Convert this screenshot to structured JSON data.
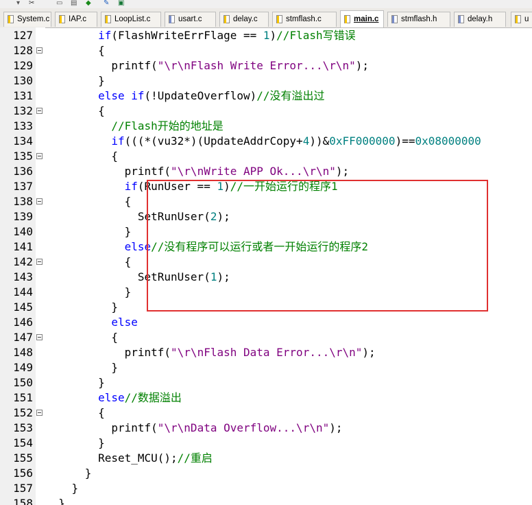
{
  "tabs": [
    {
      "name": "System.c",
      "active": false,
      "icon": "yellow"
    },
    {
      "name": "IAP.c",
      "active": false,
      "icon": "yellow"
    },
    {
      "name": "LoopList.c",
      "active": false,
      "icon": "yellow"
    },
    {
      "name": "usart.c",
      "active": false,
      "icon": "blue"
    },
    {
      "name": "delay.c",
      "active": false,
      "icon": "yellow"
    },
    {
      "name": "stmflash.c",
      "active": false,
      "icon": "yellow"
    },
    {
      "name": "main.c",
      "active": true,
      "icon": "yellow"
    },
    {
      "name": "stmflash.h",
      "active": false,
      "icon": "blue"
    },
    {
      "name": "delay.h",
      "active": false,
      "icon": "blue"
    },
    {
      "name": "u",
      "active": false,
      "icon": "yellow"
    }
  ],
  "lines": [
    {
      "n": "127",
      "fold": false,
      "segs": [
        [
          "t",
          "        "
        ],
        [
          "kw",
          "if"
        ],
        [
          "t",
          "(FlashWriteErrFlage == "
        ],
        [
          "num",
          "1"
        ],
        [
          "t",
          ")"
        ],
        [
          "cm",
          "//Flash写错误"
        ]
      ]
    },
    {
      "n": "128",
      "fold": true,
      "segs": [
        [
          "t",
          "        {"
        ]
      ]
    },
    {
      "n": "129",
      "fold": false,
      "segs": [
        [
          "t",
          "          printf("
        ],
        [
          "str",
          "\"\\r\\nFlash Write Error...\\r\\n\""
        ],
        [
          "t",
          ");"
        ]
      ]
    },
    {
      "n": "130",
      "fold": false,
      "segs": [
        [
          "t",
          "        }"
        ]
      ]
    },
    {
      "n": "131",
      "fold": false,
      "segs": [
        [
          "t",
          "        "
        ],
        [
          "kw",
          "else if"
        ],
        [
          "t",
          "(!UpdateOverflow)"
        ],
        [
          "cm",
          "//没有溢出过"
        ]
      ]
    },
    {
      "n": "132",
      "fold": true,
      "segs": [
        [
          "t",
          "        {"
        ]
      ]
    },
    {
      "n": "133",
      "fold": false,
      "segs": [
        [
          "t",
          "          "
        ],
        [
          "cm",
          "//Flash开始的地址是"
        ]
      ]
    },
    {
      "n": "134",
      "fold": false,
      "segs": [
        [
          "t",
          "          "
        ],
        [
          "kw",
          "if"
        ],
        [
          "t",
          "(((*(vu32*)(UpdateAddrCopy+"
        ],
        [
          "num",
          "4"
        ],
        [
          "t",
          "))&"
        ],
        [
          "num",
          "0xFF000000"
        ],
        [
          "t",
          ")=="
        ],
        [
          "num",
          "0x08000000"
        ]
      ]
    },
    {
      "n": "135",
      "fold": true,
      "segs": [
        [
          "t",
          "          {"
        ]
      ]
    },
    {
      "n": "136",
      "fold": false,
      "segs": [
        [
          "t",
          "            printf("
        ],
        [
          "str",
          "\"\\r\\nWrite APP Ok...\\r\\n\""
        ],
        [
          "t",
          ");"
        ]
      ]
    },
    {
      "n": "137",
      "fold": false,
      "segs": [
        [
          "t",
          "            "
        ],
        [
          "kw",
          "if"
        ],
        [
          "t",
          "(RunUser == "
        ],
        [
          "num",
          "1"
        ],
        [
          "t",
          ")"
        ],
        [
          "cm",
          "//一开始运行的程序1"
        ]
      ]
    },
    {
      "n": "138",
      "fold": true,
      "segs": [
        [
          "t",
          "            {"
        ]
      ]
    },
    {
      "n": "139",
      "fold": false,
      "segs": [
        [
          "t",
          "              SetRunUser("
        ],
        [
          "num",
          "2"
        ],
        [
          "t",
          ");"
        ]
      ]
    },
    {
      "n": "140",
      "fold": false,
      "segs": [
        [
          "t",
          "            }"
        ]
      ]
    },
    {
      "n": "141",
      "fold": false,
      "segs": [
        [
          "t",
          "            "
        ],
        [
          "kw",
          "else"
        ],
        [
          "cm",
          "//没有程序可以运行或者一开始运行的程序2"
        ]
      ]
    },
    {
      "n": "142",
      "fold": true,
      "segs": [
        [
          "t",
          "            {"
        ]
      ]
    },
    {
      "n": "143",
      "fold": false,
      "segs": [
        [
          "t",
          "              SetRunUser("
        ],
        [
          "num",
          "1"
        ],
        [
          "t",
          ");"
        ]
      ]
    },
    {
      "n": "144",
      "fold": false,
      "segs": [
        [
          "t",
          "            }"
        ]
      ]
    },
    {
      "n": "145",
      "fold": false,
      "segs": [
        [
          "t",
          "          }"
        ]
      ]
    },
    {
      "n": "146",
      "fold": false,
      "segs": [
        [
          "t",
          "          "
        ],
        [
          "kw",
          "else"
        ]
      ]
    },
    {
      "n": "147",
      "fold": true,
      "segs": [
        [
          "t",
          "          {"
        ]
      ]
    },
    {
      "n": "148",
      "fold": false,
      "segs": [
        [
          "t",
          "            printf("
        ],
        [
          "str",
          "\"\\r\\nFlash Data Error...\\r\\n\""
        ],
        [
          "t",
          ");"
        ]
      ]
    },
    {
      "n": "149",
      "fold": false,
      "segs": [
        [
          "t",
          "          }"
        ]
      ]
    },
    {
      "n": "150",
      "fold": false,
      "segs": [
        [
          "t",
          "        }"
        ]
      ]
    },
    {
      "n": "151",
      "fold": false,
      "segs": [
        [
          "t",
          "        "
        ],
        [
          "kw",
          "else"
        ],
        [
          "cm",
          "//数据溢出"
        ]
      ]
    },
    {
      "n": "152",
      "fold": true,
      "segs": [
        [
          "t",
          "        {"
        ]
      ]
    },
    {
      "n": "153",
      "fold": false,
      "segs": [
        [
          "t",
          "          printf("
        ],
        [
          "str",
          "\"\\r\\nData Overflow...\\r\\n\""
        ],
        [
          "t",
          ");"
        ]
      ]
    },
    {
      "n": "154",
      "fold": false,
      "segs": [
        [
          "t",
          "        }"
        ]
      ]
    },
    {
      "n": "155",
      "fold": false,
      "segs": [
        [
          "t",
          "        Reset_MCU();"
        ],
        [
          "cm",
          "//重启"
        ]
      ]
    },
    {
      "n": "156",
      "fold": false,
      "segs": [
        [
          "t",
          "      }"
        ]
      ]
    },
    {
      "n": "157",
      "fold": false,
      "segs": [
        [
          "t",
          "    }"
        ]
      ]
    },
    {
      "n": "158",
      "fold": false,
      "segs": [
        [
          "t",
          "  }"
        ]
      ]
    }
  ]
}
